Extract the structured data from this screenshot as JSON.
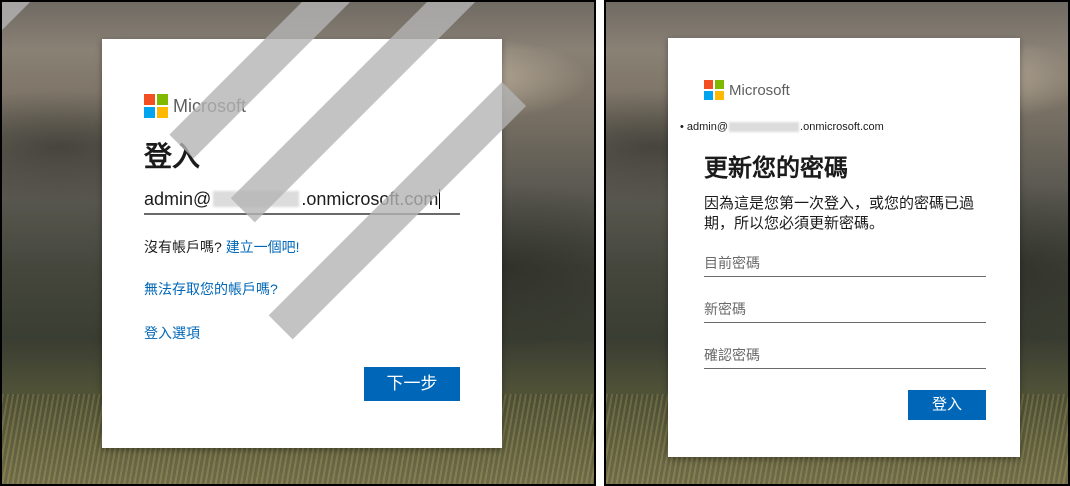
{
  "left_screen": {
    "brand": "Microsoft",
    "title": "登入",
    "email_prefix": "admin@",
    "email_suffix": ".onmicrosoft.com",
    "no_account_text": "沒有帳戶嗎?",
    "create_link": "建立一個吧!",
    "cant_access_link": "無法存取您的帳戶嗎?",
    "signin_options_link": "登入選項",
    "next_button": "下一步"
  },
  "right_screen": {
    "brand": "Microsoft",
    "account_prefix": "• admin@",
    "account_suffix": ".onmicrosoft.com",
    "title": "更新您的密碼",
    "description": "因為這是您第一次登入，或您的密碼已過期，所以您必須更新密碼。",
    "current_password_placeholder": "目前密碼",
    "new_password_placeholder": "新密碼",
    "confirm_password_placeholder": "確認密碼",
    "signin_button": "登入"
  },
  "colors": {
    "accent_blue": "#0067b8",
    "ms_red": "#f25022",
    "ms_green": "#7fba00",
    "ms_blue": "#00a4ef",
    "ms_yellow": "#ffb900"
  }
}
